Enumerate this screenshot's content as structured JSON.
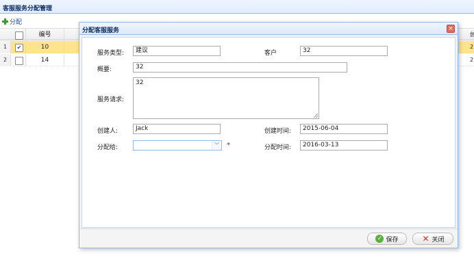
{
  "panel": {
    "title": "客服服务分配管理"
  },
  "toolbar": {
    "assign_label": "分配"
  },
  "grid": {
    "header": {
      "id": "编号"
    },
    "rows": [
      {
        "rownum": "1",
        "id": "10",
        "checked": true,
        "trail": "2"
      },
      {
        "rownum": "2",
        "id": "14",
        "checked": false,
        "trail": "2"
      }
    ],
    "far_header": "创"
  },
  "dialog": {
    "title": "分配客服服务",
    "close_glyph": "×",
    "form": {
      "service_type_label": "服务类型:",
      "service_type_value": "建议",
      "customer_label": "客户",
      "customer_value": "32",
      "summary_label": "概要:",
      "summary_value": "32",
      "request_label": "服务请求:",
      "request_value": "32",
      "creator_label": "创建人:",
      "creator_value": "Jack",
      "create_time_label": "创建时间:",
      "create_time_value": "2015-06-04",
      "assign_to_label": "分配给:",
      "assign_to_value": "",
      "required_mark": "*",
      "assign_time_label": "分配时间:",
      "assign_time_value": "2016-03-13"
    },
    "buttons": {
      "save_label": "保存",
      "close_label": "关闭"
    }
  },
  "colors": {
    "accent_border": "#95b8e7",
    "selected_row": "#ffe48d",
    "required": "#d60000"
  },
  "icons": [
    "plus-icon",
    "checkbox-icon",
    "close-icon",
    "dropdown-arrow-icon",
    "check-icon",
    "cancel-icon"
  ]
}
